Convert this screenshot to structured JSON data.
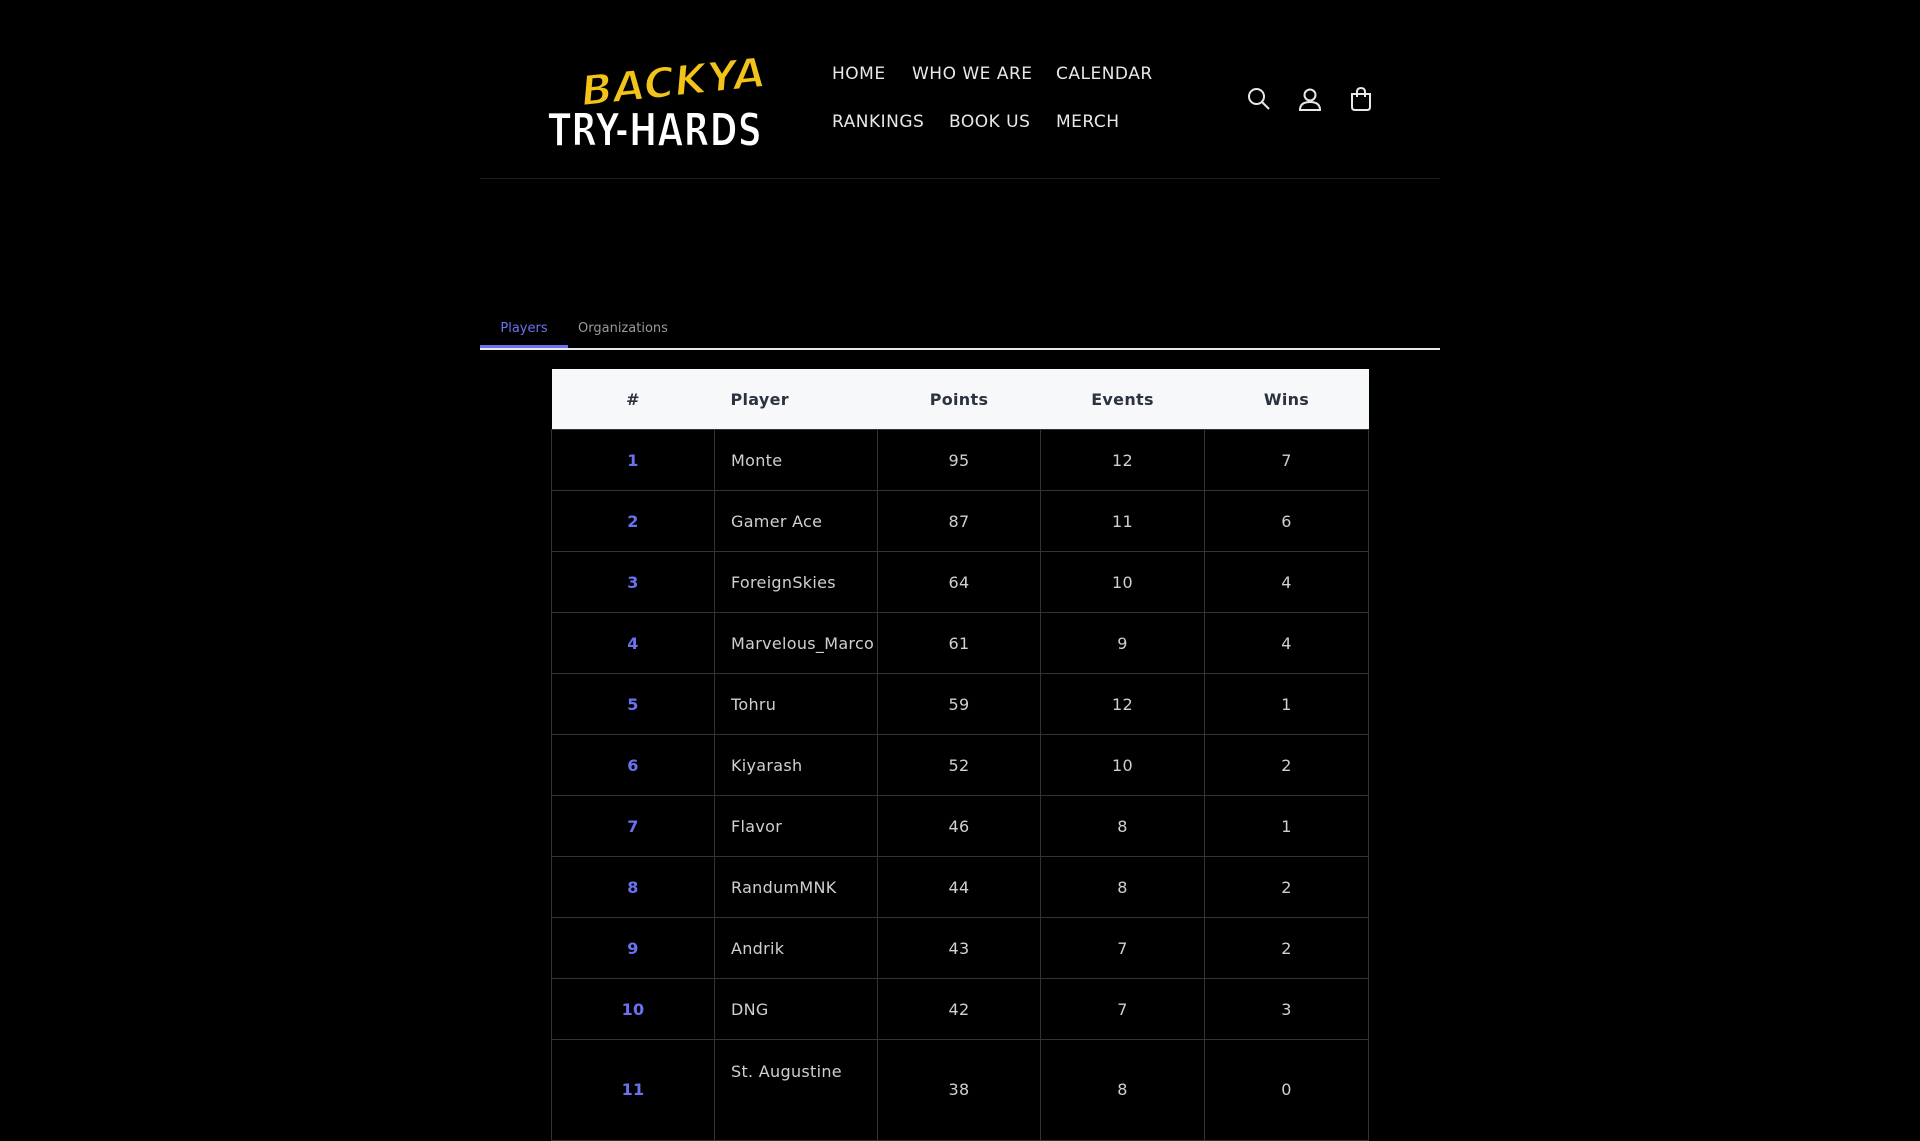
{
  "brand": {
    "logo_line1": "BACKYARD",
    "logo_line2": "TRY-HARDS",
    "accent_color": "#f2c318"
  },
  "nav": {
    "items": [
      "HOME",
      "WHO WE ARE",
      "CALENDAR",
      "RANKINGS",
      "BOOK US",
      "MERCH"
    ]
  },
  "header_icons": [
    "search-icon",
    "account-icon",
    "cart-icon"
  ],
  "tabs": [
    {
      "label": "Players",
      "active": true
    },
    {
      "label": "Organizations",
      "active": false
    }
  ],
  "table": {
    "headers": [
      "#",
      "Player",
      "Points",
      "Events",
      "Wins"
    ],
    "rows": [
      {
        "rank": "1",
        "player": "Monte",
        "points": "95",
        "events": "12",
        "wins": "7"
      },
      {
        "rank": "2",
        "player": "Gamer Ace",
        "points": "87",
        "events": "11",
        "wins": "6"
      },
      {
        "rank": "3",
        "player": "ForeignSkies",
        "points": "64",
        "events": "10",
        "wins": "4"
      },
      {
        "rank": "4",
        "player": "Marvelous_Marco",
        "points": "61",
        "events": "9",
        "wins": "4"
      },
      {
        "rank": "5",
        "player": "Tohru",
        "points": "59",
        "events": "12",
        "wins": "1"
      },
      {
        "rank": "6",
        "player": "Kiyarash",
        "points": "52",
        "events": "10",
        "wins": "2"
      },
      {
        "rank": "7",
        "player": "Flavor",
        "points": "46",
        "events": "8",
        "wins": "1"
      },
      {
        "rank": "8",
        "player": "RandumMNK",
        "points": "44",
        "events": "8",
        "wins": "2"
      },
      {
        "rank": "9",
        "player": "Andrik",
        "points": "43",
        "events": "7",
        "wins": "2"
      },
      {
        "rank": "10",
        "player": "DNG",
        "points": "42",
        "events": "7",
        "wins": "3"
      },
      {
        "rank": "11",
        "player": "St. Augustine",
        "points": "38",
        "events": "8",
        "wins": "0"
      }
    ]
  },
  "colors": {
    "background": "#000000",
    "accent": "#6b72f0",
    "header_row_bg": "#f7f8fa"
  }
}
